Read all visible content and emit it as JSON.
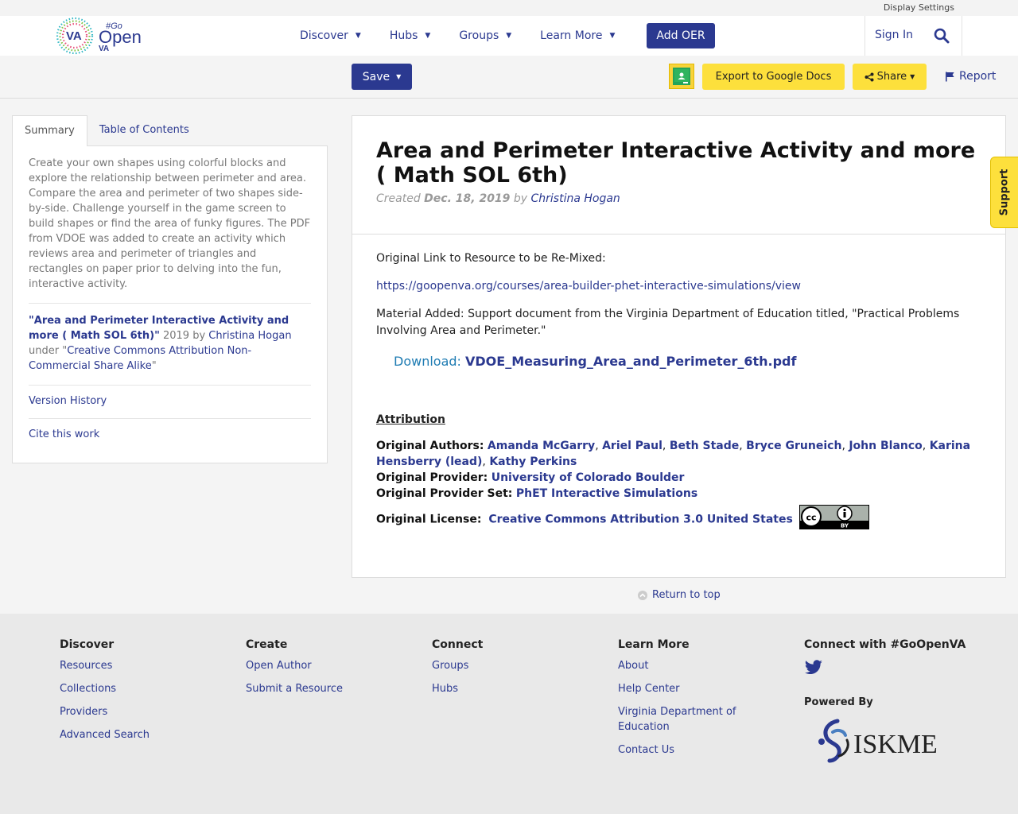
{
  "topbar": {
    "display_settings": "Display Settings"
  },
  "header": {
    "logo_text_va": "VA",
    "logo_text_go": "#Go",
    "logo_text_open": "Open",
    "logo_text_va2": "VA",
    "nav": [
      "Discover",
      "Hubs",
      "Groups",
      "Learn More"
    ],
    "add_oer": "Add OER",
    "sign_in": "Sign In"
  },
  "toolbar": {
    "save": "Save",
    "export": "Export to Google Docs",
    "share": "Share",
    "report": "Report"
  },
  "sidebar": {
    "tabs": [
      "Summary",
      "Table of Contents"
    ],
    "summary": "Create your own shapes using colorful blocks and explore the relationship between perimeter and area. Compare the area and perimeter of two shapes side-by-side. Challenge yourself in the game screen to build shapes or find the area of funky figures. The PDF from VDOE was added to create an activity which reviews area and perimeter of triangles and rectangles on paper prior to delving into the fun, interactive activity.",
    "cite_title": "\"Area and Perimeter Interactive Activity and more ( Math SOL 6th)\"",
    "cite_year": " 2019 by ",
    "cite_author": "Christina Hogan",
    "cite_under": "under \"",
    "cite_license": "Creative Commons Attribution Non-Commercial Share Alike",
    "cite_end": "\"",
    "version_history": "Version History",
    "cite_this": "Cite this work"
  },
  "main": {
    "title": "Area and Perimeter Interactive Activity and more ( Math SOL 6th)",
    "created_label": "Created ",
    "created_date": "Dec. 18, 2019",
    "by": " by ",
    "author": "Christina Hogan",
    "original_link_label": "Original Link to Resource to be Re-Mixed:",
    "original_link": "https://goopenva.org/courses/area-builder-phet-interactive-simulations/view",
    "material": "Material Added: Support document from the Virginia Department of Education titled, \"Practical Problems Involving Area and Perimeter.\"",
    "download_label": "Download: ",
    "download_file": "VDOE_Measuring_Area_and_Perimeter_6th.pdf",
    "attribution_heading": "Attribution",
    "authors_label": "Original Authors:",
    "authors": [
      "Amanda McGarry",
      "Ariel Paul",
      "Beth Stade",
      "Bryce Gruneich",
      "John Blanco",
      "Karina Hensberry (lead)",
      "Kathy Perkins"
    ],
    "provider_label": "Original Provider:",
    "provider": "University of Colorado Boulder",
    "provider_set_label": "Original Provider Set:",
    "provider_set": "PhET Interactive Simulations",
    "license_label": "Original License:",
    "license": "Creative Commons Attribution 3.0 United States",
    "cc_badge_text": "BY"
  },
  "support": "Support",
  "return_top": "Return to top",
  "footer": {
    "discover": {
      "heading": "Discover",
      "links": [
        "Resources",
        "Collections",
        "Providers",
        "Advanced Search"
      ]
    },
    "create": {
      "heading": "Create",
      "links": [
        "Open Author",
        "Submit a Resource"
      ]
    },
    "connect": {
      "heading": "Connect",
      "links": [
        "Groups",
        "Hubs"
      ]
    },
    "learn": {
      "heading": "Learn More",
      "links": [
        "About",
        "Help Center",
        "Virginia Department of Education",
        "Contact Us"
      ]
    },
    "social": {
      "heading": "Connect with #GoOpenVA"
    },
    "powered_by": "Powered By",
    "iskme": "ISKME"
  },
  "colors": {
    "brand_blue": "#2b3990",
    "yellow": "#fde03c",
    "cyan": "#1f7cb3"
  }
}
